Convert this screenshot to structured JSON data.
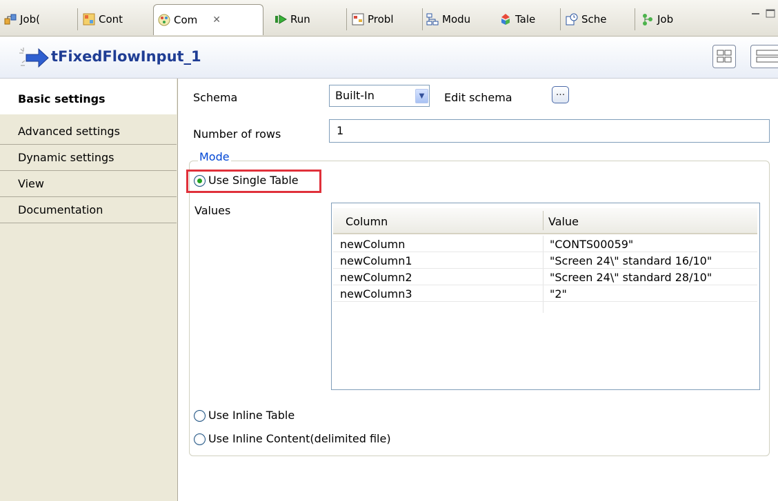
{
  "tabs": [
    {
      "label": "Job(",
      "icon": "job-design-icon"
    },
    {
      "label": "Cont",
      "icon": "context-icon"
    },
    {
      "label": "Com",
      "icon": "component-icon",
      "active": true
    },
    {
      "label": "Run",
      "icon": "run-icon"
    },
    {
      "label": "Probl",
      "icon": "problems-icon"
    },
    {
      "label": "Modu",
      "icon": "modules-icon"
    },
    {
      "label": "Tale",
      "icon": "talend-exchange-icon"
    },
    {
      "label": "Sche",
      "icon": "scheduler-icon"
    },
    {
      "label": "Job",
      "icon": "job-hierarchy-icon"
    }
  ],
  "component": {
    "title": "tFixedFlowInput_1"
  },
  "nav": {
    "items": [
      "Basic settings",
      "Advanced settings",
      "Dynamic settings",
      "View",
      "Documentation"
    ],
    "active": "Basic settings"
  },
  "form": {
    "schema_label": "Schema",
    "schema_value": "Built-In",
    "edit_schema_label": "Edit schema",
    "edit_schema_button": "...",
    "rows_label": "Number of rows",
    "rows_value": "1",
    "mode_label": "Mode",
    "mode_options": [
      "Use Single Table",
      "Use Inline Table",
      "Use Inline Content(delimited file)"
    ],
    "mode_selected": "Use Single Table",
    "values_label": "Values"
  },
  "table": {
    "headers": [
      "Column",
      "Value"
    ],
    "rows": [
      [
        "newColumn",
        "\"CONTS00059\""
      ],
      [
        "newColumn1",
        "\"Screen 24\\\" standard 16/10\""
      ],
      [
        "newColumn2",
        "\"Screen 24\\\" standard 28/10\""
      ],
      [
        "newColumn3",
        "\"2\""
      ]
    ]
  },
  "colors": {
    "accent": "#1f3d94",
    "highlight": "#e0303a",
    "mode_legend": "#0046d5"
  }
}
